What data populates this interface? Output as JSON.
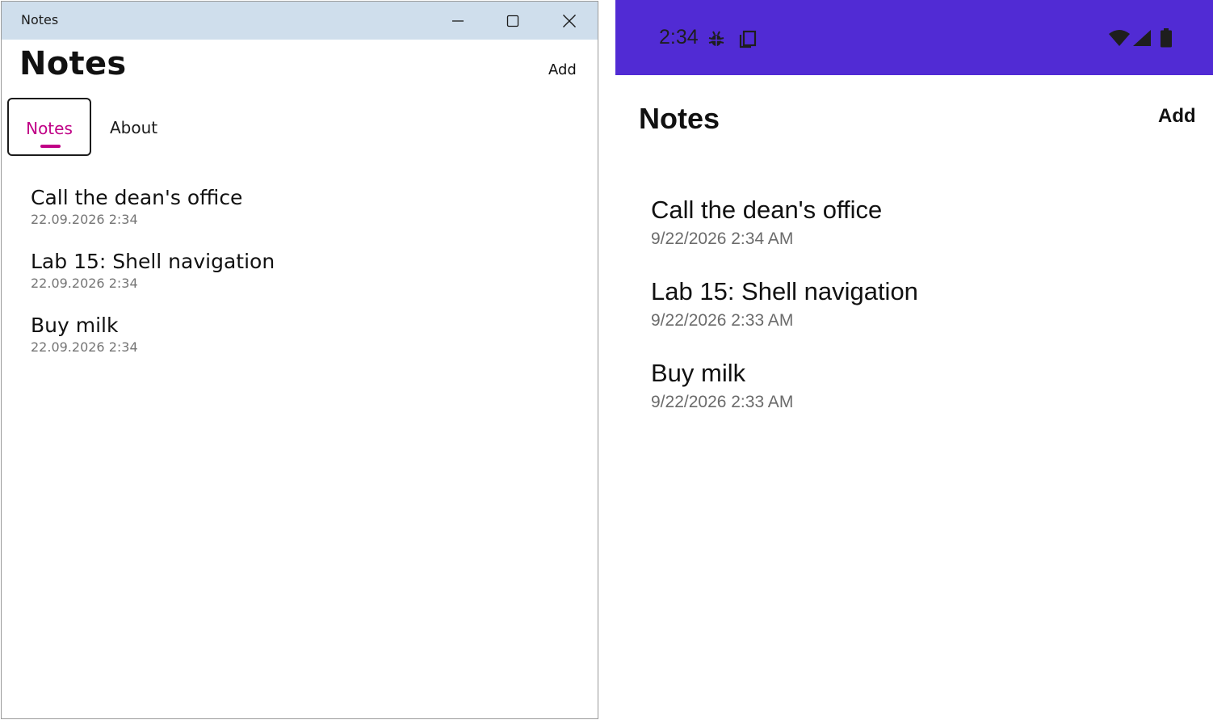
{
  "windows_app": {
    "window_title": "Notes",
    "page_title": "Notes",
    "add_label": "Add",
    "tabs": [
      {
        "label": "Notes",
        "selected": true
      },
      {
        "label": "About",
        "selected": false
      }
    ],
    "notes": [
      {
        "title": "Call the dean's office",
        "date": "22.09.2026 2:34"
      },
      {
        "title": "Lab 15: Shell navigation",
        "date": "22.09.2026 2:34"
      },
      {
        "title": "Buy milk",
        "date": "22.09.2026 2:34"
      }
    ],
    "icons": [
      "minimize-icon",
      "maximize-icon",
      "close-icon"
    ],
    "colors": {
      "titlebar": "#cfdeec",
      "accent": "#c00086"
    }
  },
  "android_app": {
    "status_time": "2:34",
    "status_icons": [
      "bug-icon",
      "copy-icon",
      "wifi-icon",
      "signal-icon",
      "battery-icon"
    ],
    "page_title": "Notes",
    "add_label": "Add",
    "notes": [
      {
        "title": "Call the dean's office",
        "date": "9/22/2026 2:34 AM"
      },
      {
        "title": "Lab 15: Shell navigation",
        "date": "9/22/2026 2:33 AM"
      },
      {
        "title": "Buy milk",
        "date": "9/22/2026 2:33 AM"
      }
    ],
    "colors": {
      "status_bar": "#512bd4"
    }
  }
}
